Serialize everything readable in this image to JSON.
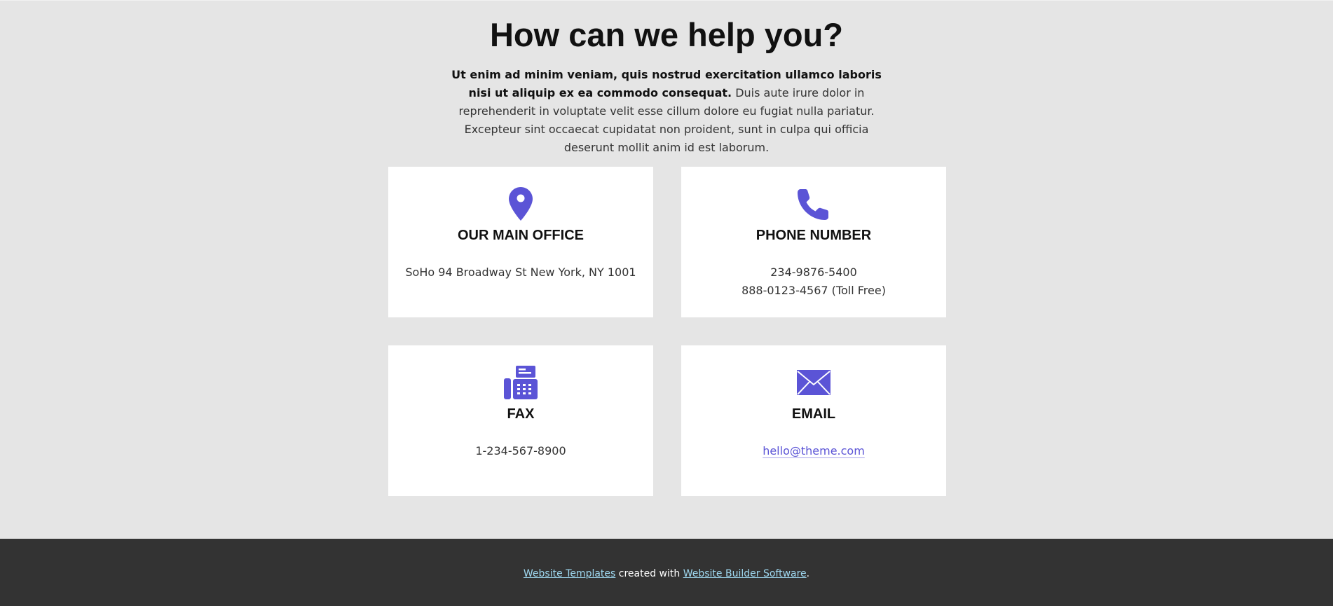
{
  "header": {
    "title": "How can we help you?",
    "intro_bold": "Ut enim ad minim veniam, quis nostrud exercitation ullamco laboris nisi ut aliquip ex ea commodo consequat.",
    "intro_rest": " Duis aute irure dolor in reprehenderit in voluptate velit esse cillum dolore eu fugiat nulla pariatur. Excepteur sint occaecat cupidatat non proident, sunt in culpa qui officia deserunt mollit anim id est laborum."
  },
  "colors": {
    "accent": "#5b54d6",
    "background": "#e5e5e5",
    "card": "#ffffff",
    "footer": "#333333",
    "footer_link": "#9fd8f0"
  },
  "cards": {
    "office": {
      "icon": "map-pin-icon",
      "title": "OUR MAIN OFFICE",
      "lines": [
        "SoHo 94 Broadway St New York, NY 1001"
      ]
    },
    "phone": {
      "icon": "phone-icon",
      "title": "PHONE NUMBER",
      "lines": [
        "234-9876-5400",
        "888-0123-4567 (Toll Free)"
      ]
    },
    "fax": {
      "icon": "fax-icon",
      "title": "FAX",
      "lines": [
        "1-234-567-8900"
      ]
    },
    "email": {
      "icon": "envelope-icon",
      "title": "EMAIL",
      "link": "hello@theme.com"
    }
  },
  "footer": {
    "link1": "Website Templates",
    "middle": " created with ",
    "link2": "Website Builder Software",
    "end": "."
  }
}
